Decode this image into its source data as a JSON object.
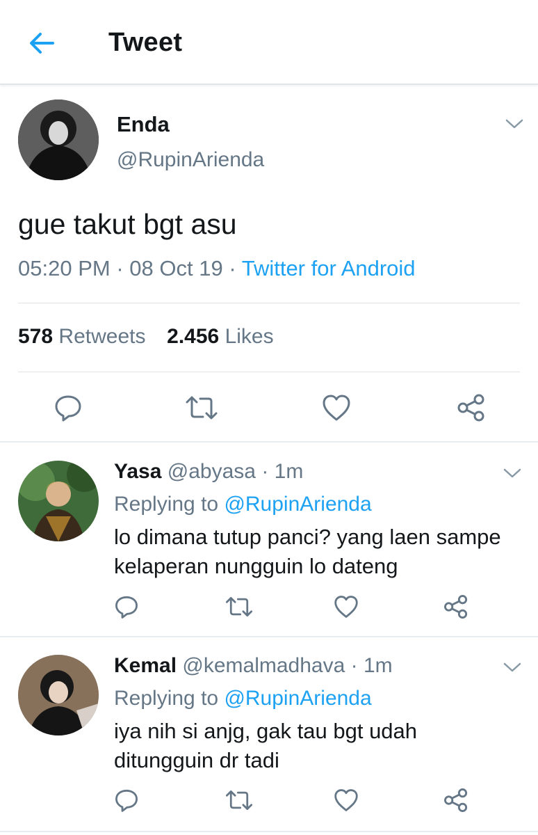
{
  "header": {
    "title": "Tweet",
    "back_icon": "arrow-left-icon"
  },
  "colors": {
    "accent": "#1da1f2",
    "muted": "#657786",
    "text": "#14171a",
    "divider": "#e1e8ed"
  },
  "tweet": {
    "display_name": "Enda",
    "handle": "@RupinArienda",
    "text": "gue takut bgt asu",
    "time": "05:20 PM",
    "date": "08 Oct 19",
    "separator": "·",
    "source": "Twitter for Android",
    "retweets_count": "578",
    "retweets_label": "Retweets",
    "likes_count": "2.456",
    "likes_label": "Likes"
  },
  "actions": [
    "reply-icon",
    "retweet-icon",
    "like-icon",
    "share-icon"
  ],
  "replies": [
    {
      "display_name": "Yasa",
      "handle": "@abyasa",
      "time": "· 1m",
      "replying_prefix": "Replying to",
      "replying_to": "@RupinArienda",
      "line1": "lo dimana tutup panci? yang laen sampe",
      "line2": "kelaperan nungguin lo dateng"
    },
    {
      "display_name": "Kemal",
      "handle": "@kemalmadhava",
      "time": "· 1m",
      "replying_prefix": "Replying to",
      "replying_to": "@RupinArienda",
      "line1": "iya nih si anjg, gak tau bgt udah",
      "line2": "ditungguin dr tadi"
    }
  ]
}
